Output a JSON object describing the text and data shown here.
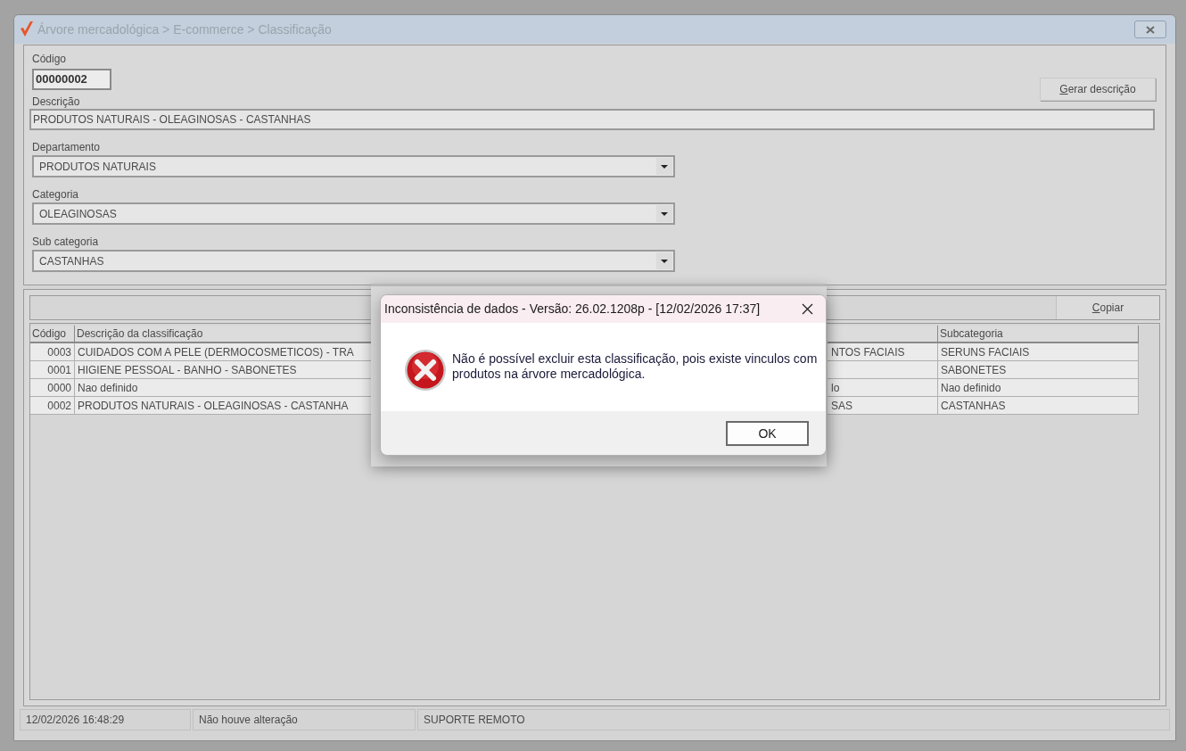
{
  "window": {
    "title": "Árvore mercadológica > E-commerce > Classificação"
  },
  "form": {
    "code": {
      "label": "Código",
      "value": "00000002"
    },
    "description": {
      "label": "Descrição",
      "value": "PRODUTOS NATURAIS - OLEAGINOSAS - CASTANHAS"
    },
    "generate_button": "Gerar descrição",
    "dropdowns": [
      {
        "label": "Departamento",
        "value": "PRODUTOS NATURAIS"
      },
      {
        "label": "Categoria",
        "value": "OLEAGINOSAS"
      },
      {
        "label": "Sub categoria",
        "value": "CASTANHAS"
      }
    ]
  },
  "table": {
    "copy_button": "Copiar",
    "columns": [
      "Código",
      "Descrição da classificação",
      "Subcategoria"
    ],
    "rows": [
      {
        "code": "0003",
        "description": "CUIDADOS COM A PELE (DERMOCOSMETICOS) - TRA",
        "column_3": "NTOS FACIAIS",
        "subcategory": "SERUNS FACIAIS"
      },
      {
        "code": "0001",
        "description": "HIGIENE PESSOAL - BANHO - SABONETES",
        "subcategory": "SABONETES"
      },
      {
        "code": "0000",
        "description": "Nao definido",
        "column_3": "lo",
        "subcategory": "Nao definido"
      },
      {
        "code": "0002",
        "description": "PRODUTOS NATURAIS - OLEAGINOSAS - CASTANHA",
        "column_3": "SAS",
        "subcategory": "CASTANHAS"
      }
    ]
  },
  "status_bar": [
    "12/02/2026 16:48:29",
    "Não houve alteração",
    "SUPORTE REMOTO"
  ],
  "dialog": {
    "title": "Inconsistência de dados - Versão: 26.02.1208p - [12/02/2026 17:37]",
    "message": "Não é possível excluir esta classificação, pois existe vinculos com produtos na árvore mercadológica.",
    "button": "OK"
  }
}
